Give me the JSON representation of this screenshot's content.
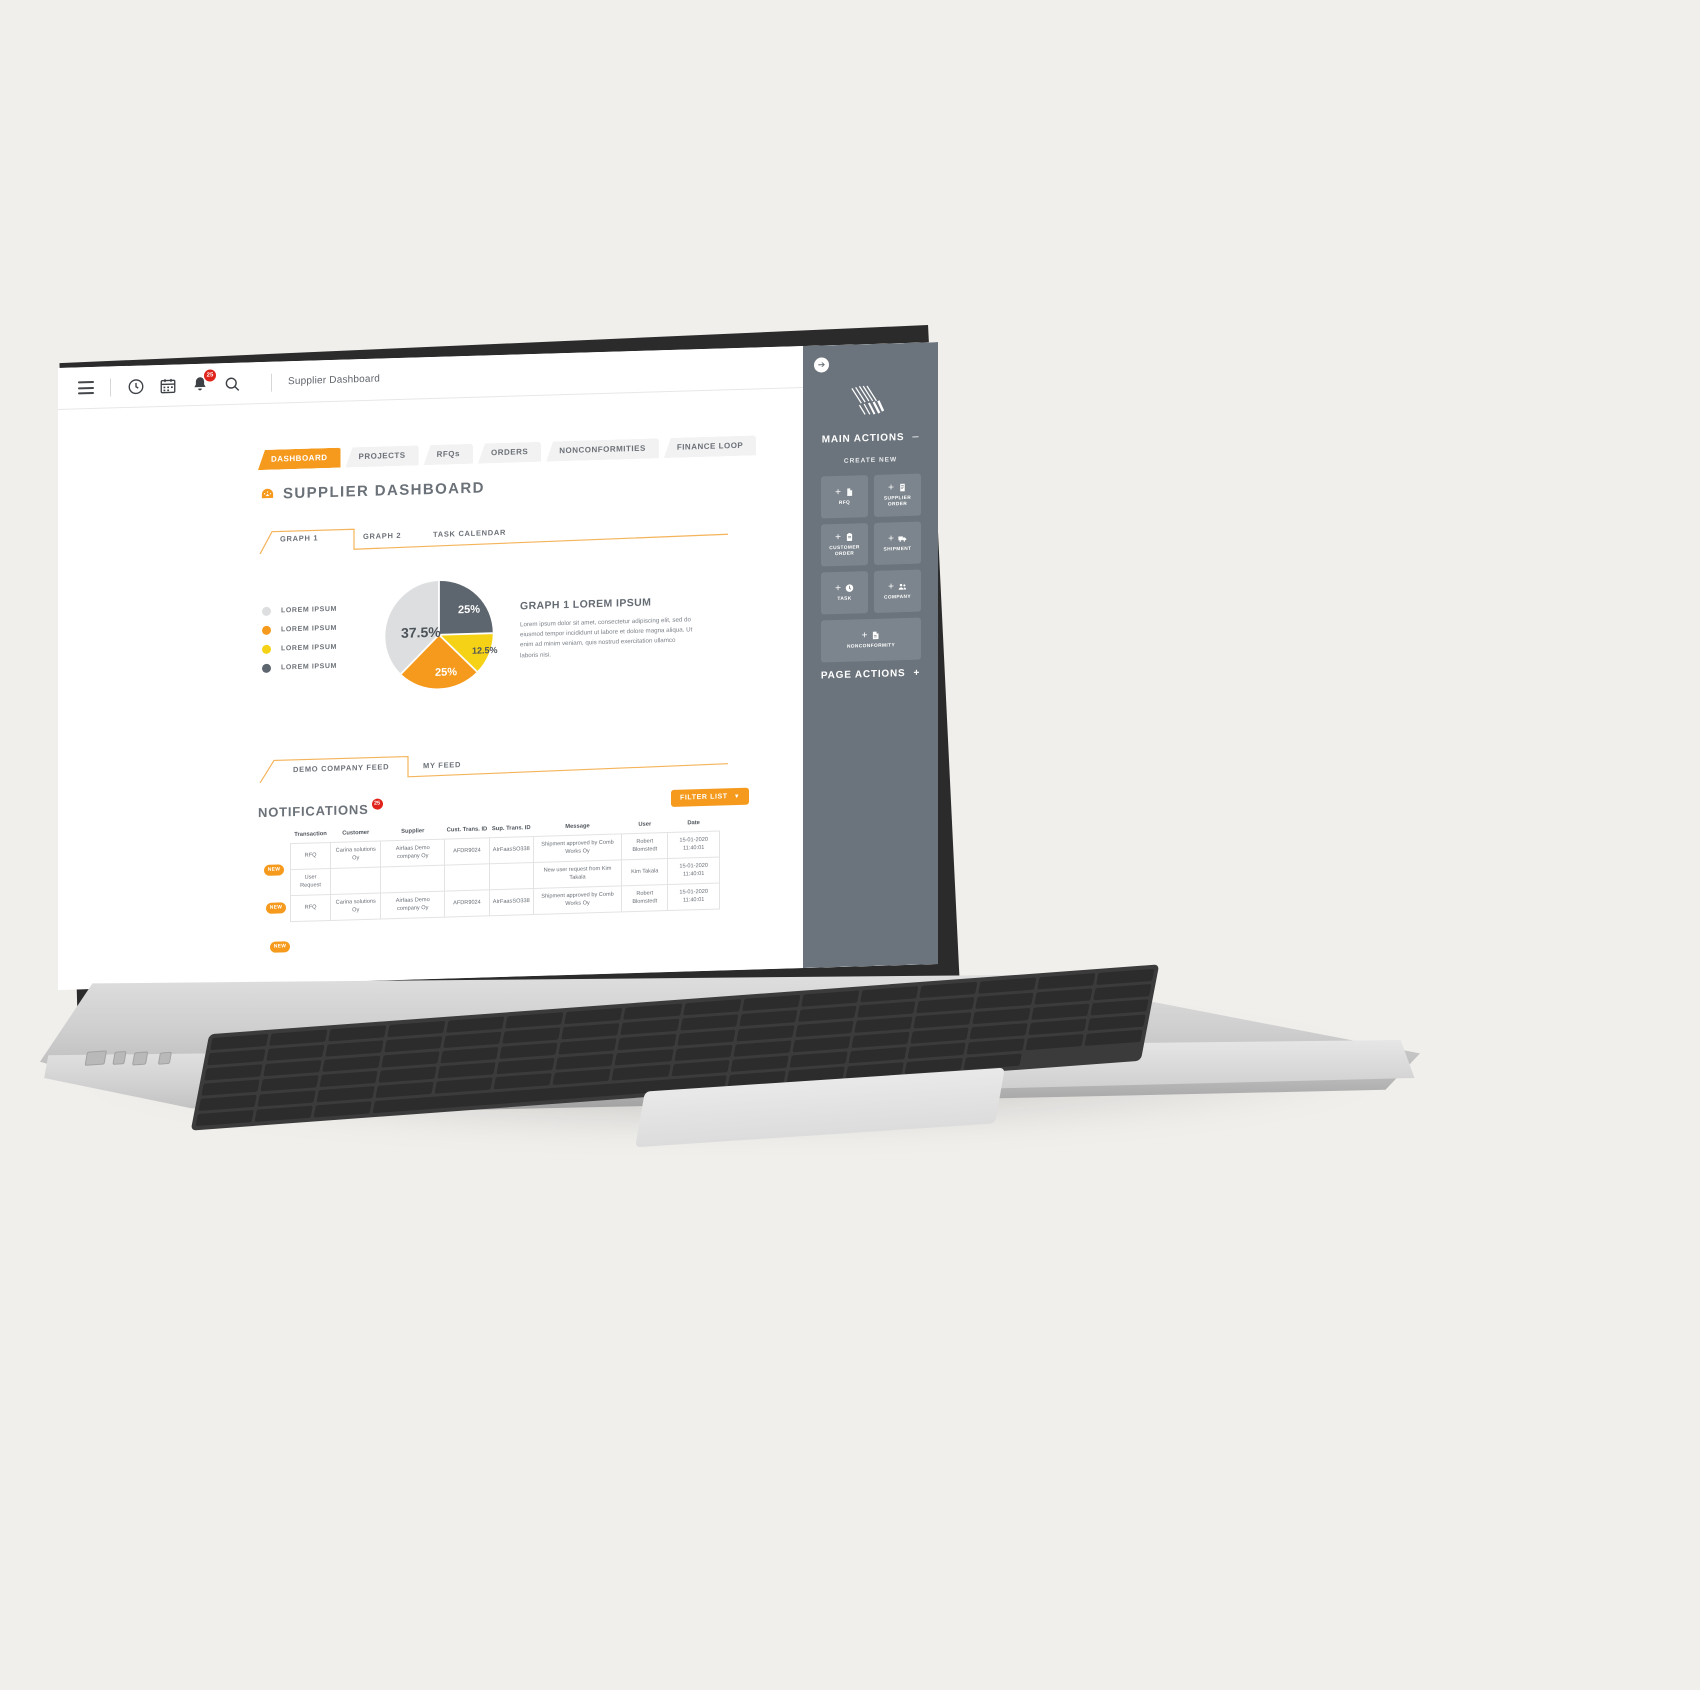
{
  "topbar": {
    "menu_icon": "hamburger-icon",
    "icons": [
      {
        "name": "clock-icon"
      },
      {
        "name": "calendar-icon"
      },
      {
        "name": "bell-icon",
        "badge": "25"
      },
      {
        "name": "search-icon"
      }
    ],
    "breadcrumb": "Supplier Dashboard"
  },
  "main_tabs": [
    {
      "label": "DASHBOARD",
      "active": true
    },
    {
      "label": "PROJECTS",
      "active": false
    },
    {
      "label": "RFQs",
      "active": false
    },
    {
      "label": "ORDERS",
      "active": false
    },
    {
      "label": "NONCONFORMITIES",
      "active": false
    },
    {
      "label": "FINANCE LOOP",
      "active": false
    }
  ],
  "page": {
    "title": "SUPPLIER DASHBOARD",
    "icon": "gauge-icon"
  },
  "graph_tabs": [
    {
      "label": "GRAPH 1",
      "active": true
    },
    {
      "label": "GRAPH 2",
      "active": false
    },
    {
      "label": "TASK CALENDAR",
      "active": false
    }
  ],
  "legend": [
    {
      "label": "LOREM IPSUM",
      "color": "#dcdedf"
    },
    {
      "label": "LOREM IPSUM",
      "color": "#f59a1d"
    },
    {
      "label": "LOREM IPSUM",
      "color": "#f5d215"
    },
    {
      "label": "LOREM IPSUM",
      "color": "#5d656e"
    }
  ],
  "graph_desc": {
    "heading": "GRAPH 1 LOREM IPSUM",
    "body": "Lorem ipsum dolor sit amet, consectetur adipiscing elit, sed do eiusmod tempor incididunt ut labore et dolore magna aliqua. Ut enim ad minim veniam, quis nostrud exercitation ullamco laboris nisi."
  },
  "chart_data": {
    "type": "pie",
    "title": "GRAPH 1 LOREM IPSUM",
    "categories": [
      "LOREM IPSUM",
      "LOREM IPSUM",
      "LOREM IPSUM",
      "LOREM IPSUM"
    ],
    "values": [
      37.5,
      25,
      12.5,
      25
    ],
    "colors": [
      "#dcdedf",
      "#5d656e",
      "#f5d215",
      "#f59a1d"
    ],
    "labels": [
      "37.5%",
      "25%",
      "12.5%",
      "25%"
    ],
    "legend_position": "left",
    "grid": false
  },
  "feed_tabs": [
    {
      "label": "DEMO COMPANY FEED",
      "active": true
    },
    {
      "label": "MY FEED",
      "active": false
    }
  ],
  "notifications": {
    "title": "NOTIFICATIONS",
    "count": "25",
    "filter_label": "FILTER LIST",
    "filter_chevron": "chevron-down-icon",
    "new_tag": "NEW",
    "columns": [
      "Transaction",
      "Customer",
      "Supplier",
      "Cust. Trans. ID",
      "Sup. Trans. ID",
      "Message",
      "User",
      "Date"
    ],
    "rows": [
      {
        "new": true,
        "transaction": "RFQ",
        "customer": "Carina solutions Oy",
        "supplier": "Airfaas Demo company Oy",
        "cust_trans_id": "AFDR9024",
        "sup_trans_id": "AIrFaasSO338",
        "message": "Shipment approved by Comb Works Oy",
        "user": "Robert Blomstedt",
        "date": "15-01-2020 11:40:01"
      },
      {
        "new": true,
        "transaction": "User Request",
        "customer": "",
        "supplier": "",
        "cust_trans_id": "",
        "sup_trans_id": "",
        "message": "New user request from Kim Takala",
        "user": "Kim Takala",
        "date": "15-01-2020 11:40:01"
      },
      {
        "new": true,
        "transaction": "RFQ",
        "customer": "Carina solutions Oy",
        "supplier": "Airfaas Demo company Oy",
        "cust_trans_id": "AFDR9024",
        "sup_trans_id": "AIrFaasSO338",
        "message": "Shipment approved by Comb Works Oy",
        "user": "Robert Blomstedt",
        "date": "15-01-2020 11:40:01"
      }
    ]
  },
  "sidebar": {
    "collapse_icon": "arrow-right-circle-icon",
    "logo": "airfaas-logo",
    "main_actions_label": "MAIN ACTIONS",
    "main_actions_sign": "–",
    "create_new_label": "CREATE NEW",
    "buttons": [
      {
        "label": "RFQ",
        "icon": "document-icon"
      },
      {
        "label": "SUPPLIER ORDER",
        "icon": "file-icon"
      },
      {
        "label": "CUSTOMER ORDER",
        "icon": "clipboard-icon"
      },
      {
        "label": "SHIPMENT",
        "icon": "truck-icon"
      },
      {
        "label": "TASK",
        "icon": "clock-icon"
      },
      {
        "label": "COMPANY",
        "icon": "people-icon"
      },
      {
        "label": "NONCONFORMITY",
        "icon": "report-icon"
      }
    ],
    "page_actions_label": "PAGE ACTIONS",
    "page_actions_sign": "+"
  },
  "colors": {
    "accent": "#f59a1d",
    "sidebar": "#6b747c",
    "badge_red": "#e0241c",
    "text": "#6b7178"
  }
}
